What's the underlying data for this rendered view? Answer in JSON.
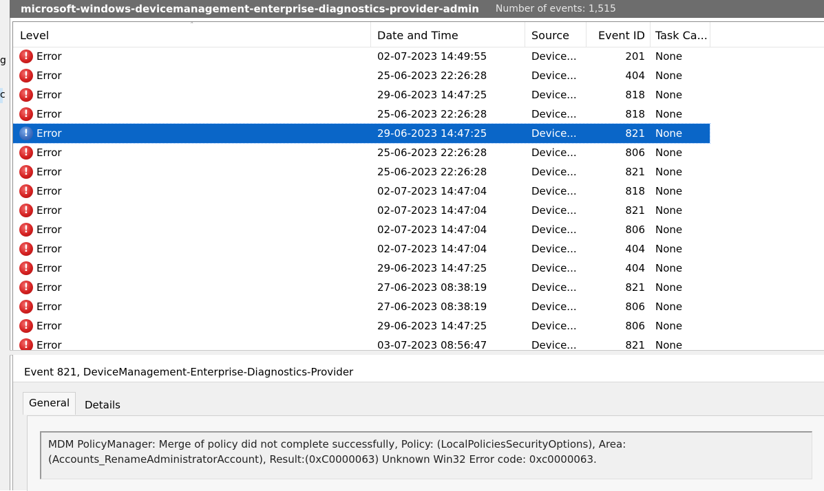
{
  "window": {
    "log_name": "microsoft-windows-devicemanagement-enterprise-diagnostics-provider-admin",
    "event_count": "Number of events: 1,515"
  },
  "left_pane": {
    "fragment_1": "g",
    "fragment_2": "c"
  },
  "columns": {
    "level": "Level",
    "date_time": "Date and Time",
    "source": "Source",
    "event_id": "Event ID",
    "task_category": "Task Ca..."
  },
  "events": [
    {
      "level": "Error",
      "date": "02-07-2023 14:49:55",
      "source": "Device...",
      "id": "201",
      "task": "None"
    },
    {
      "level": "Error",
      "date": "25-06-2023 22:26:28",
      "source": "Device...",
      "id": "404",
      "task": "None"
    },
    {
      "level": "Error",
      "date": "29-06-2023 14:47:25",
      "source": "Device...",
      "id": "818",
      "task": "None"
    },
    {
      "level": "Error",
      "date": "25-06-2023 22:26:28",
      "source": "Device...",
      "id": "818",
      "task": "None"
    },
    {
      "level": "Error",
      "date": "29-06-2023 14:47:25",
      "source": "Device...",
      "id": "821",
      "task": "None",
      "selected": true
    },
    {
      "level": "Error",
      "date": "25-06-2023 22:26:28",
      "source": "Device...",
      "id": "806",
      "task": "None"
    },
    {
      "level": "Error",
      "date": "25-06-2023 22:26:28",
      "source": "Device...",
      "id": "821",
      "task": "None"
    },
    {
      "level": "Error",
      "date": "02-07-2023 14:47:04",
      "source": "Device...",
      "id": "818",
      "task": "None"
    },
    {
      "level": "Error",
      "date": "02-07-2023 14:47:04",
      "source": "Device...",
      "id": "821",
      "task": "None"
    },
    {
      "level": "Error",
      "date": "02-07-2023 14:47:04",
      "source": "Device...",
      "id": "806",
      "task": "None"
    },
    {
      "level": "Error",
      "date": "02-07-2023 14:47:04",
      "source": "Device...",
      "id": "404",
      "task": "None"
    },
    {
      "level": "Error",
      "date": "29-06-2023 14:47:25",
      "source": "Device...",
      "id": "404",
      "task": "None"
    },
    {
      "level": "Error",
      "date": "27-06-2023 08:38:19",
      "source": "Device...",
      "id": "821",
      "task": "None"
    },
    {
      "level": "Error",
      "date": "27-06-2023 08:38:19",
      "source": "Device...",
      "id": "806",
      "task": "None"
    },
    {
      "level": "Error",
      "date": "29-06-2023 14:47:25",
      "source": "Device...",
      "id": "806",
      "task": "None"
    },
    {
      "level": "Error",
      "date": "03-07-2023 08:56:47",
      "source": "Device...",
      "id": "821",
      "task": "None"
    }
  ],
  "icons": {
    "error": "error-icon",
    "sort": "sort-ascending-icon"
  },
  "colors": {
    "selection": "#0a66c8",
    "error": "#d42121",
    "titlebar": "#6d6d6d"
  },
  "detail": {
    "title": "Event 821, DeviceManagement-Enterprise-Diagnostics-Provider",
    "tabs": {
      "general": "General",
      "details": "Details"
    },
    "message_line1": "MDM PolicyManager: Merge of policy did not complete successfully, Policy: (LocalPoliciesSecurityOptions), Area:",
    "message_line2": "(Accounts_RenameAdministratorAccount), Result:(0xC0000063) Unknown Win32 Error code: 0xc0000063."
  }
}
